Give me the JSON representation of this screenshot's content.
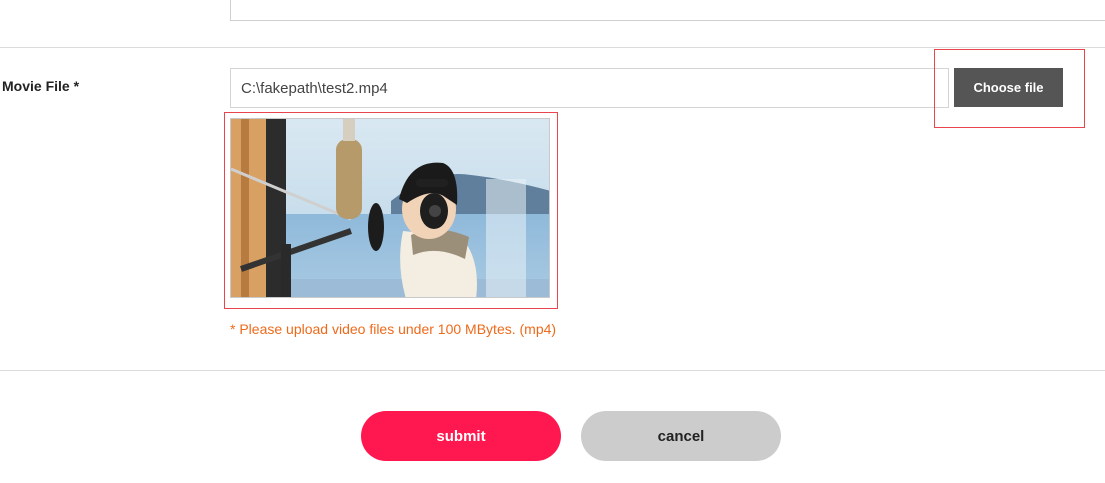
{
  "form": {
    "movie_label": "Movie File *",
    "file_value": "C:\\fakepath\\test2.mp4",
    "choose_label": "Choose file",
    "upload_hint": "* Please upload video files under 100 MBytes. (mp4)"
  },
  "actions": {
    "submit_label": "submit",
    "cancel_label": "cancel"
  },
  "colors": {
    "accent": "#ff1850",
    "hint": "#ee6a1b",
    "highlight_box": "#e8454f",
    "choose_button": "#555555",
    "cancel_button": "#cccccc"
  }
}
